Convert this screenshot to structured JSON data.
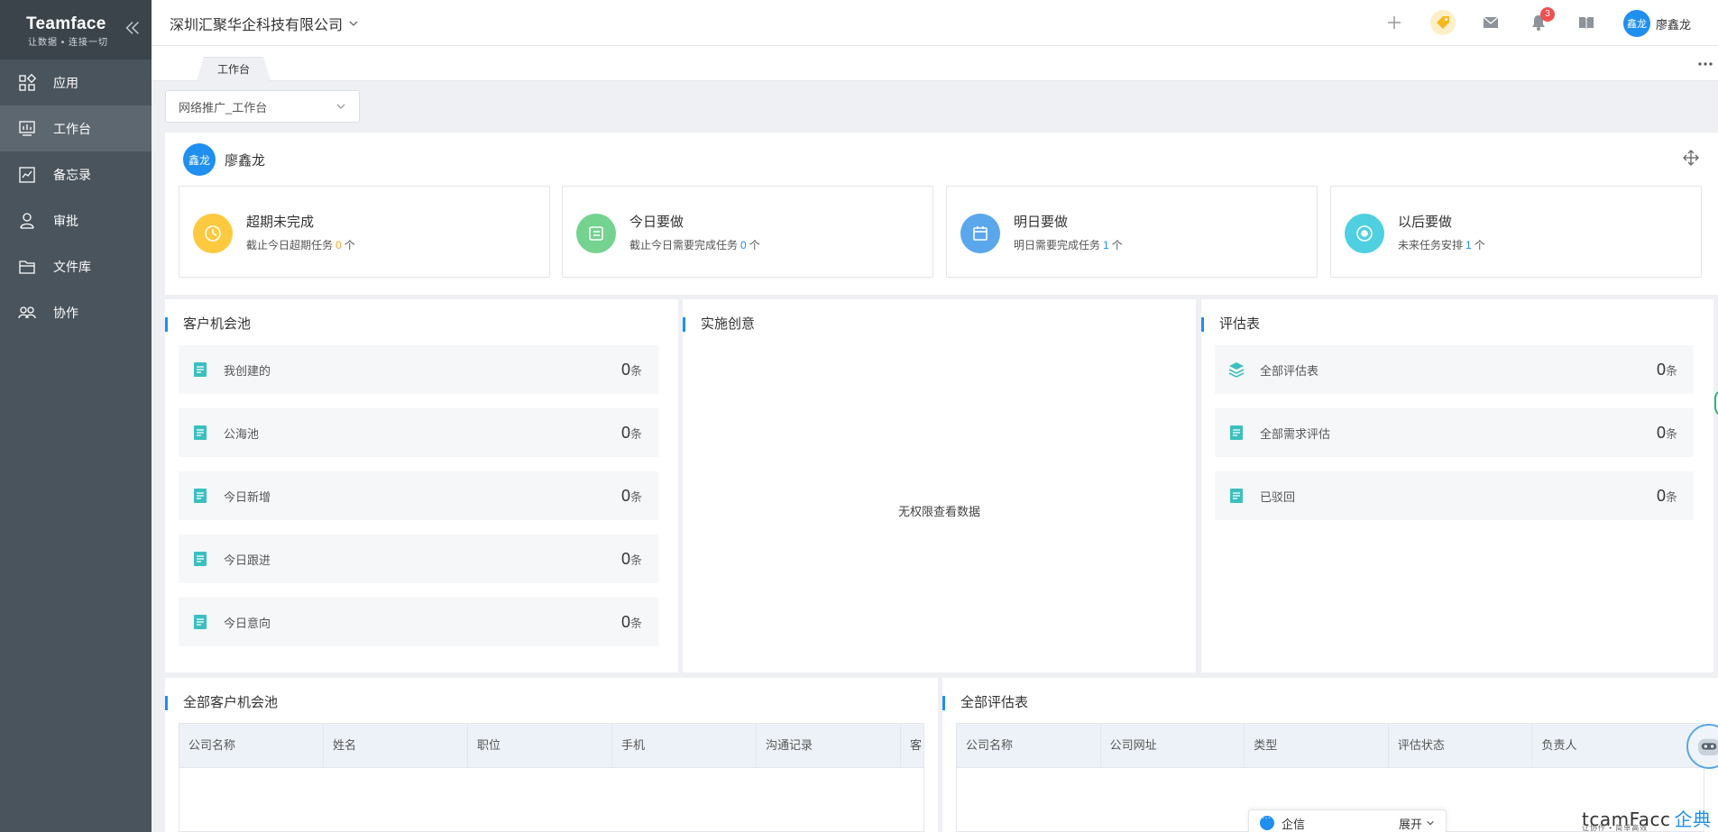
{
  "brand": {
    "title": "Teamface",
    "slogan": "让数据 • 连接一切"
  },
  "sidebar": {
    "items": [
      {
        "label": "应用",
        "icon": "apps-icon"
      },
      {
        "label": "工作台",
        "icon": "workbench-icon",
        "active": true
      },
      {
        "label": "备忘录",
        "icon": "memo-icon"
      },
      {
        "label": "审批",
        "icon": "approval-icon"
      },
      {
        "label": "文件库",
        "icon": "folder-icon"
      },
      {
        "label": "协作",
        "icon": "team-icon"
      }
    ]
  },
  "header": {
    "company": "深圳汇聚华企科技有限公司",
    "notification_count": "3",
    "user_avatar": "鑫龙",
    "user_name": "廖鑫龙"
  },
  "tabs": [
    {
      "label": "工作台",
      "active": true
    }
  ],
  "workbench_select": {
    "value": "网络推广_工作台"
  },
  "task_panel": {
    "avatar": "鑫龙",
    "user_name": "廖鑫龙",
    "cards": [
      {
        "title": "超期未完成",
        "prefix": "截止今日超期任务",
        "count": "0",
        "suffix": "个",
        "color": "#fcc93f",
        "count_color": "#f5a623"
      },
      {
        "title": "今日要做",
        "prefix": "截止今日需要完成任务",
        "count": "0",
        "suffix": "个",
        "color": "#74d38f",
        "count_color": "#1f8ff0"
      },
      {
        "title": "明日要做",
        "prefix": "明日需要完成任务",
        "count": "1",
        "suffix": "个",
        "color": "#5aa7ec",
        "count_color": "#1f8ff0"
      },
      {
        "title": "以后要做",
        "prefix": "未来任务安排",
        "count": "1",
        "suffix": "个",
        "color": "#4fd0e0",
        "count_color": "#1f8ff0"
      }
    ]
  },
  "customer_pool": {
    "title": "客户机会池",
    "rows": [
      {
        "label": "我创建的",
        "value": "0",
        "unit": "条"
      },
      {
        "label": "公海池",
        "value": "0",
        "unit": "条"
      },
      {
        "label": "今日新增",
        "value": "0",
        "unit": "条"
      },
      {
        "label": "今日跟进",
        "value": "0",
        "unit": "条"
      },
      {
        "label": "今日意向",
        "value": "0",
        "unit": "条"
      }
    ]
  },
  "ideas": {
    "title": "实施创意",
    "empty_text": "无权限查看数据"
  },
  "evaluation": {
    "title": "评估表",
    "rows": [
      {
        "label": "全部评估表",
        "value": "0",
        "unit": "条"
      },
      {
        "label": "全部需求评估",
        "value": "0",
        "unit": "条"
      },
      {
        "label": "已驳回",
        "value": "0",
        "unit": "条"
      }
    ]
  },
  "all_customers": {
    "title": "全部客户机会池",
    "columns": [
      "公司名称",
      "姓名",
      "职位",
      "手机",
      "沟通记录",
      "客"
    ]
  },
  "all_evaluations": {
    "title": "全部评估表",
    "columns": [
      "公司名称",
      "公司网址",
      "类型",
      "评估状态",
      "负责人"
    ]
  },
  "im_bar": {
    "label": "企信",
    "action": "展开"
  },
  "footer_logo": {
    "text": "tcamFacc",
    "cn": "企典",
    "slogan": "让协作 • 简单高效"
  },
  "colors": {
    "accent": "#1f8ff0",
    "sidebar": "#4a545c",
    "sidebar_active": "#5d676f"
  }
}
